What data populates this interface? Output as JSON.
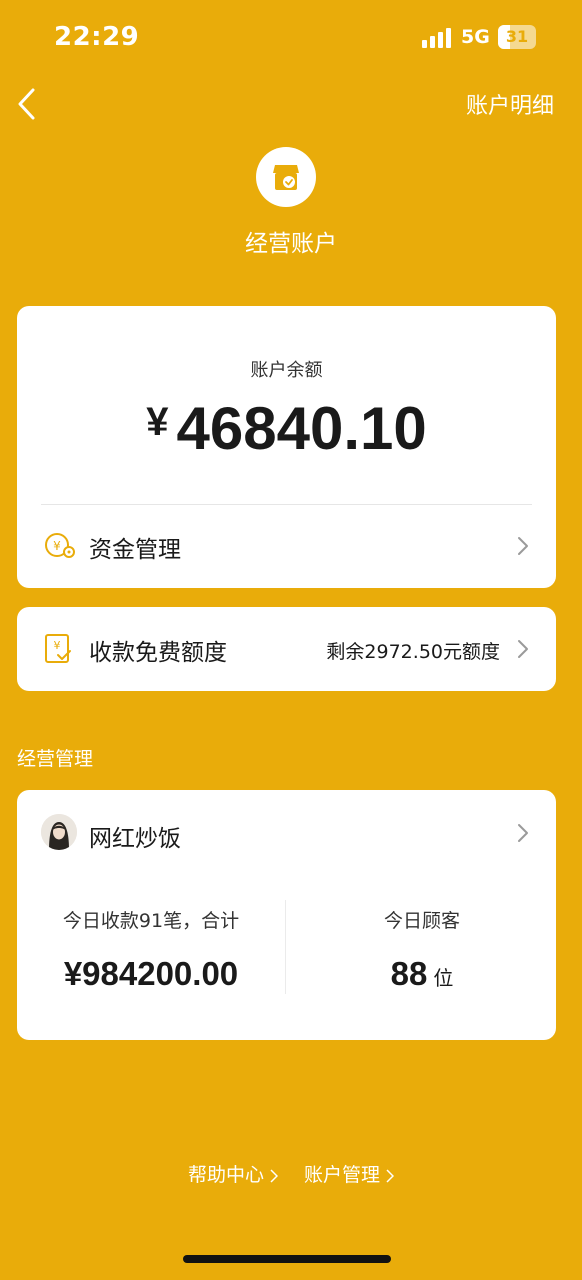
{
  "status_bar": {
    "time": "22:29",
    "network": "5G",
    "battery": "31"
  },
  "nav": {
    "right_link": "账户明细"
  },
  "header": {
    "title": "经营账户"
  },
  "balance": {
    "label": "账户余额",
    "currency": "¥",
    "amount": "46840.10"
  },
  "fund_management": {
    "label": "资金管理"
  },
  "quota": {
    "label": "收款免费额度",
    "value": "剩余2972.50元额度"
  },
  "section_title": "经营管理",
  "business": {
    "shop_name": "网红炒饭",
    "today_payments_label": "今日收款91笔，合计",
    "today_payments_amount": "¥984200.00",
    "today_customers_label": "今日顾客",
    "today_customers_value": "88",
    "today_customers_unit": "位"
  },
  "footer": {
    "help": "帮助中心",
    "account": "账户管理"
  },
  "colors": {
    "background": "#E9AC0A",
    "card": "#FFFFFF",
    "icon_accent": "#E9AC0A"
  }
}
